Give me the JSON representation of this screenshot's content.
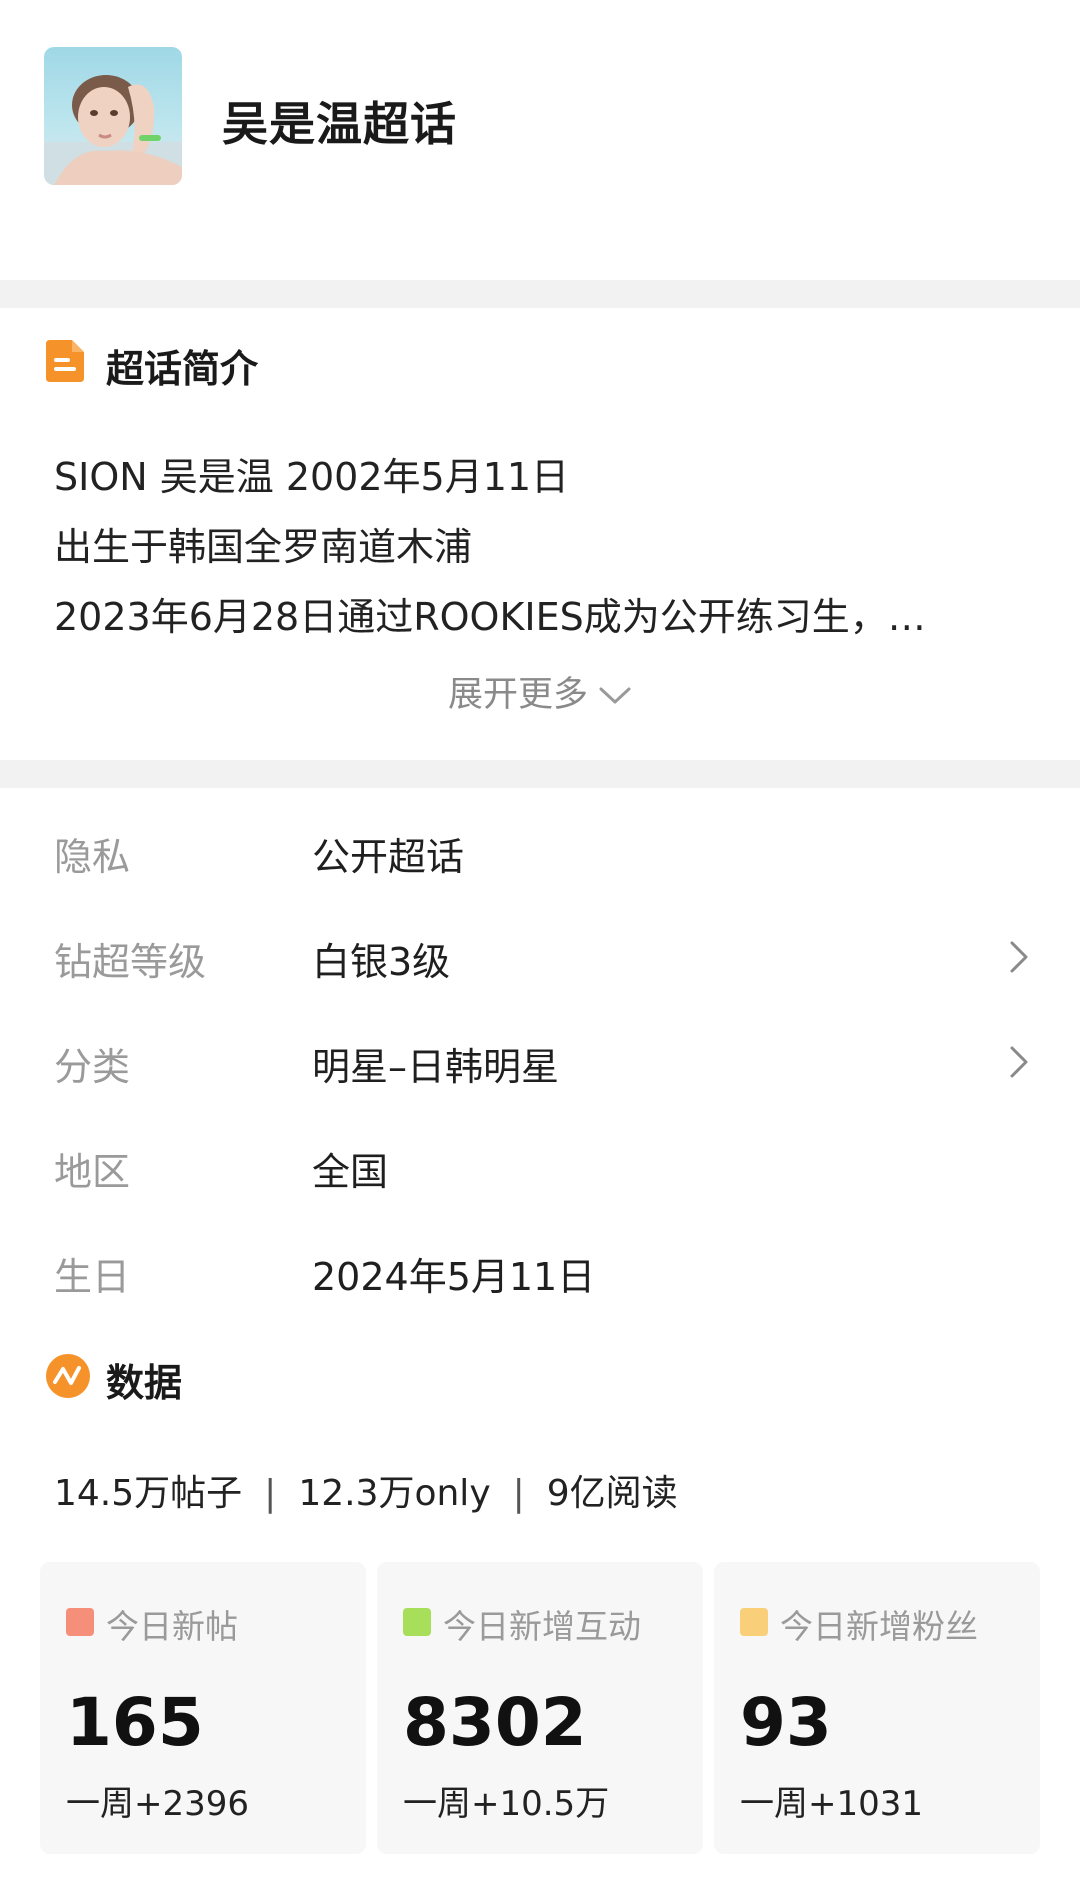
{
  "header": {
    "title": "吴是温超话"
  },
  "intro": {
    "section_title": "超话简介",
    "icon": "document-icon",
    "lines": [
      "SION  吴是温 2002年5月11日",
      "出生于韩国全罗南道木浦",
      "2023年6月28日通过ROOKIES成为公开练习生，…"
    ],
    "expand_label": "展开更多"
  },
  "info": {
    "rows": [
      {
        "label": "隐私",
        "value": "公开超话"
      },
      {
        "label": "钻超等级",
        "value": "白银3级"
      },
      {
        "label": "分类",
        "value": "明星–日韩明星"
      },
      {
        "label": "地区",
        "value": "全国"
      },
      {
        "label": "生日",
        "value": "2024年5月11日"
      }
    ]
  },
  "data": {
    "section_title": "数据",
    "icon": "trend-icon",
    "stats": [
      "14.5万帖子",
      "12.3万only",
      "9亿阅读"
    ],
    "cards": [
      {
        "label": "今日新帖",
        "value": "165",
        "week": "一周+2396",
        "color": "#f58f7a"
      },
      {
        "label": "今日新增互动",
        "value": "8302",
        "week": "一周+10.5万",
        "color": "#a8df5a"
      },
      {
        "label": "今日新增粉丝",
        "value": "93",
        "week": "一周+1031",
        "color": "#f9cf7a"
      }
    ]
  },
  "colors": {
    "accent_orange": "#f6922a",
    "divider": "#f2f2f2"
  }
}
